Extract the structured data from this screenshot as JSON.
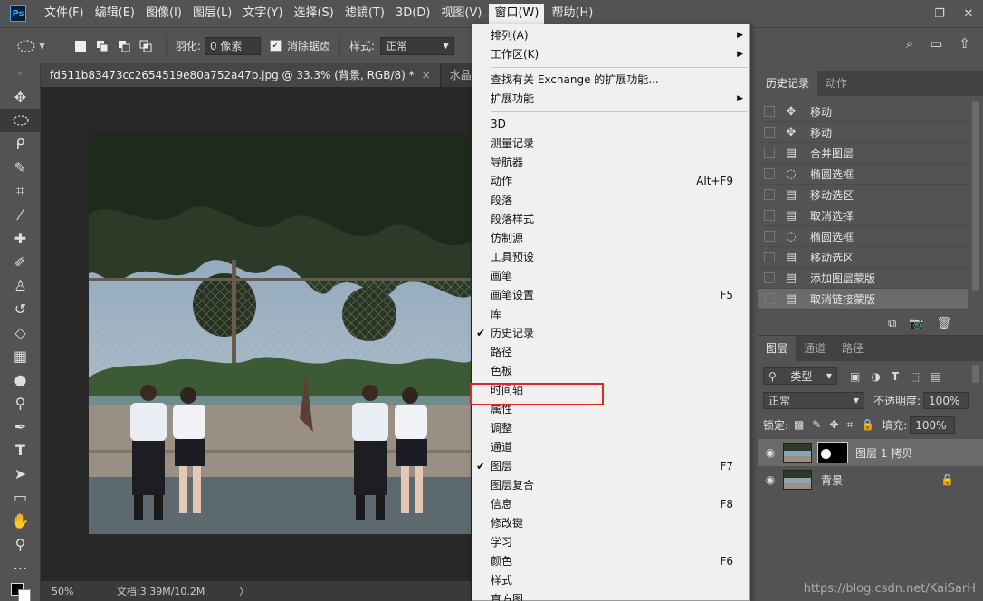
{
  "app": {
    "logo": "Ps"
  },
  "menubar": {
    "items": [
      "文件(F)",
      "编辑(E)",
      "图像(I)",
      "图层(L)",
      "文字(Y)",
      "选择(S)",
      "滤镜(T)",
      "3D(D)",
      "视图(V)",
      "窗口(W)",
      "帮助(H)"
    ],
    "active": "窗口(W)",
    "window_buttons": [
      "—",
      "❐",
      "✕"
    ]
  },
  "options_bar": {
    "feather_label": "羽化:",
    "feather_value": "0 像素",
    "antialias_label": "消除锯齿",
    "antialias_checked": true,
    "style_label": "样式:",
    "style_value": "正常"
  },
  "tabs": [
    {
      "label": "fd511b83473cc2654519e80a752a47b.jpg @ 33.3% (背景, RGB/8) *",
      "close": "×"
    },
    {
      "label": "水晶球.jpg @",
      "close": ""
    }
  ],
  "statusbar": {
    "zoom": "50%",
    "doc": "文档:3.39M/10.2M",
    "arrow": "〉"
  },
  "window_menu": {
    "groups": [
      [
        {
          "label": "排列(A)",
          "submenu": true
        },
        {
          "label": "工作区(K)",
          "submenu": true
        }
      ],
      [
        {
          "label": "查找有关 Exchange 的扩展功能..."
        },
        {
          "label": "扩展功能",
          "submenu": true
        }
      ],
      [
        {
          "label": "3D"
        },
        {
          "label": "测量记录"
        },
        {
          "label": "导航器"
        },
        {
          "label": "动作",
          "shortcut": "Alt+F9"
        },
        {
          "label": "段落"
        },
        {
          "label": "段落样式"
        },
        {
          "label": "仿制源"
        },
        {
          "label": "工具预设"
        },
        {
          "label": "画笔"
        },
        {
          "label": "画笔设置",
          "shortcut": "F5"
        },
        {
          "label": "库"
        },
        {
          "label": "历史记录",
          "checked": true
        },
        {
          "label": "路径"
        },
        {
          "label": "色板"
        },
        {
          "label": "时间轴",
          "highlighted": true
        },
        {
          "label": "属性"
        },
        {
          "label": "调整"
        },
        {
          "label": "通道"
        },
        {
          "label": "图层",
          "checked": true,
          "shortcut": "F7"
        },
        {
          "label": "图层复合"
        },
        {
          "label": "信息",
          "shortcut": "F8"
        },
        {
          "label": "修改键"
        },
        {
          "label": "学习"
        },
        {
          "label": "颜色",
          "shortcut": "F6"
        },
        {
          "label": "样式"
        },
        {
          "label": "直方图"
        }
      ]
    ]
  },
  "history_panel": {
    "tabs": [
      "历史记录",
      "动作"
    ],
    "items": [
      {
        "label": "移动",
        "icon": "move-icon"
      },
      {
        "label": "移动",
        "icon": "move-icon"
      },
      {
        "label": "合并图层",
        "icon": "document-icon"
      },
      {
        "label": "椭圆选框",
        "icon": "ellipse-marquee-icon"
      },
      {
        "label": "移动选区",
        "icon": "document-icon"
      },
      {
        "label": "取消选择",
        "icon": "document-icon"
      },
      {
        "label": "椭圆选框",
        "icon": "ellipse-marquee-icon"
      },
      {
        "label": "移动选区",
        "icon": "document-icon"
      },
      {
        "label": "添加图层蒙版",
        "icon": "document-icon"
      },
      {
        "label": "取消链接蒙版",
        "icon": "document-icon",
        "current": true
      }
    ]
  },
  "layers_panel": {
    "tabs": [
      "图层",
      "通道",
      "路径"
    ],
    "filter_label": "类型",
    "blend_mode": "正常",
    "opacity_label": "不透明度:",
    "opacity_value": "100%",
    "lock_label": "锁定:",
    "fill_label": "填充:",
    "fill_value": "100%",
    "layers": [
      {
        "name": "图层 1 拷贝",
        "has_mask": true,
        "selected": true
      },
      {
        "name": "背景",
        "locked": true
      }
    ]
  },
  "watermark": "https://blog.csdn.net/KaiSarH",
  "colors": {
    "highlight_box": "#e0262b",
    "menu_bg": "#f0f0f0",
    "ps_blue": "#31a8ff"
  }
}
